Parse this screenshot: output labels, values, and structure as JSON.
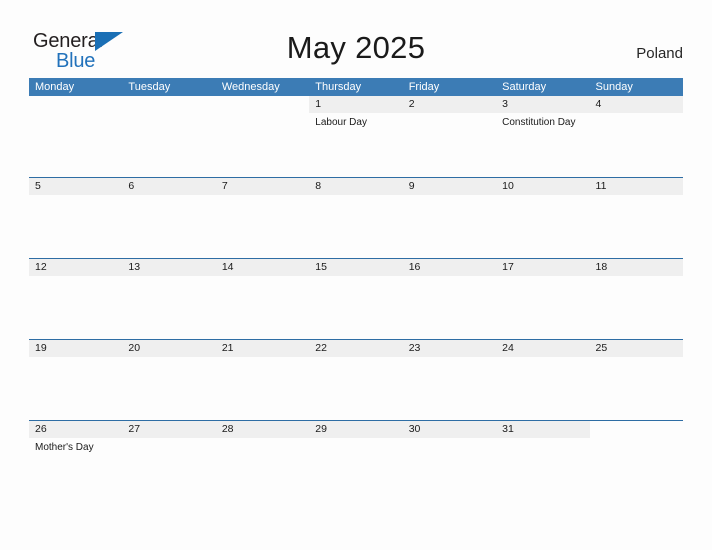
{
  "brand": {
    "name_part1": "General",
    "name_part2": "Blue",
    "flag_icon": "flag-triangle-icon",
    "accent_color": "#2272bb"
  },
  "header": {
    "title": "May 2025",
    "country": "Poland"
  },
  "theme": {
    "header_blue": "#3c7cb5",
    "band_gray": "#efefef",
    "rule_blue": "#2e6da4",
    "page_background": "#fdfdfd"
  },
  "calendar": {
    "weekday_headers": [
      "Monday",
      "Tuesday",
      "Wednesday",
      "Thursday",
      "Friday",
      "Saturday",
      "Sunday"
    ],
    "weeks": [
      [
        {
          "day": "",
          "events": []
        },
        {
          "day": "",
          "events": []
        },
        {
          "day": "",
          "events": []
        },
        {
          "day": "1",
          "events": [
            "Labour Day"
          ]
        },
        {
          "day": "2",
          "events": []
        },
        {
          "day": "3",
          "events": [
            "Constitution Day"
          ]
        },
        {
          "day": "4",
          "events": []
        }
      ],
      [
        {
          "day": "5",
          "events": []
        },
        {
          "day": "6",
          "events": []
        },
        {
          "day": "7",
          "events": []
        },
        {
          "day": "8",
          "events": []
        },
        {
          "day": "9",
          "events": []
        },
        {
          "day": "10",
          "events": []
        },
        {
          "day": "11",
          "events": []
        }
      ],
      [
        {
          "day": "12",
          "events": []
        },
        {
          "day": "13",
          "events": []
        },
        {
          "day": "14",
          "events": []
        },
        {
          "day": "15",
          "events": []
        },
        {
          "day": "16",
          "events": []
        },
        {
          "day": "17",
          "events": []
        },
        {
          "day": "18",
          "events": []
        }
      ],
      [
        {
          "day": "19",
          "events": []
        },
        {
          "day": "20",
          "events": []
        },
        {
          "day": "21",
          "events": []
        },
        {
          "day": "22",
          "events": []
        },
        {
          "day": "23",
          "events": []
        },
        {
          "day": "24",
          "events": []
        },
        {
          "day": "25",
          "events": []
        }
      ],
      [
        {
          "day": "26",
          "events": [
            "Mother's Day"
          ]
        },
        {
          "day": "27",
          "events": []
        },
        {
          "day": "28",
          "events": []
        },
        {
          "day": "29",
          "events": []
        },
        {
          "day": "30",
          "events": []
        },
        {
          "day": "31",
          "events": []
        },
        {
          "day": "",
          "events": []
        }
      ]
    ]
  }
}
